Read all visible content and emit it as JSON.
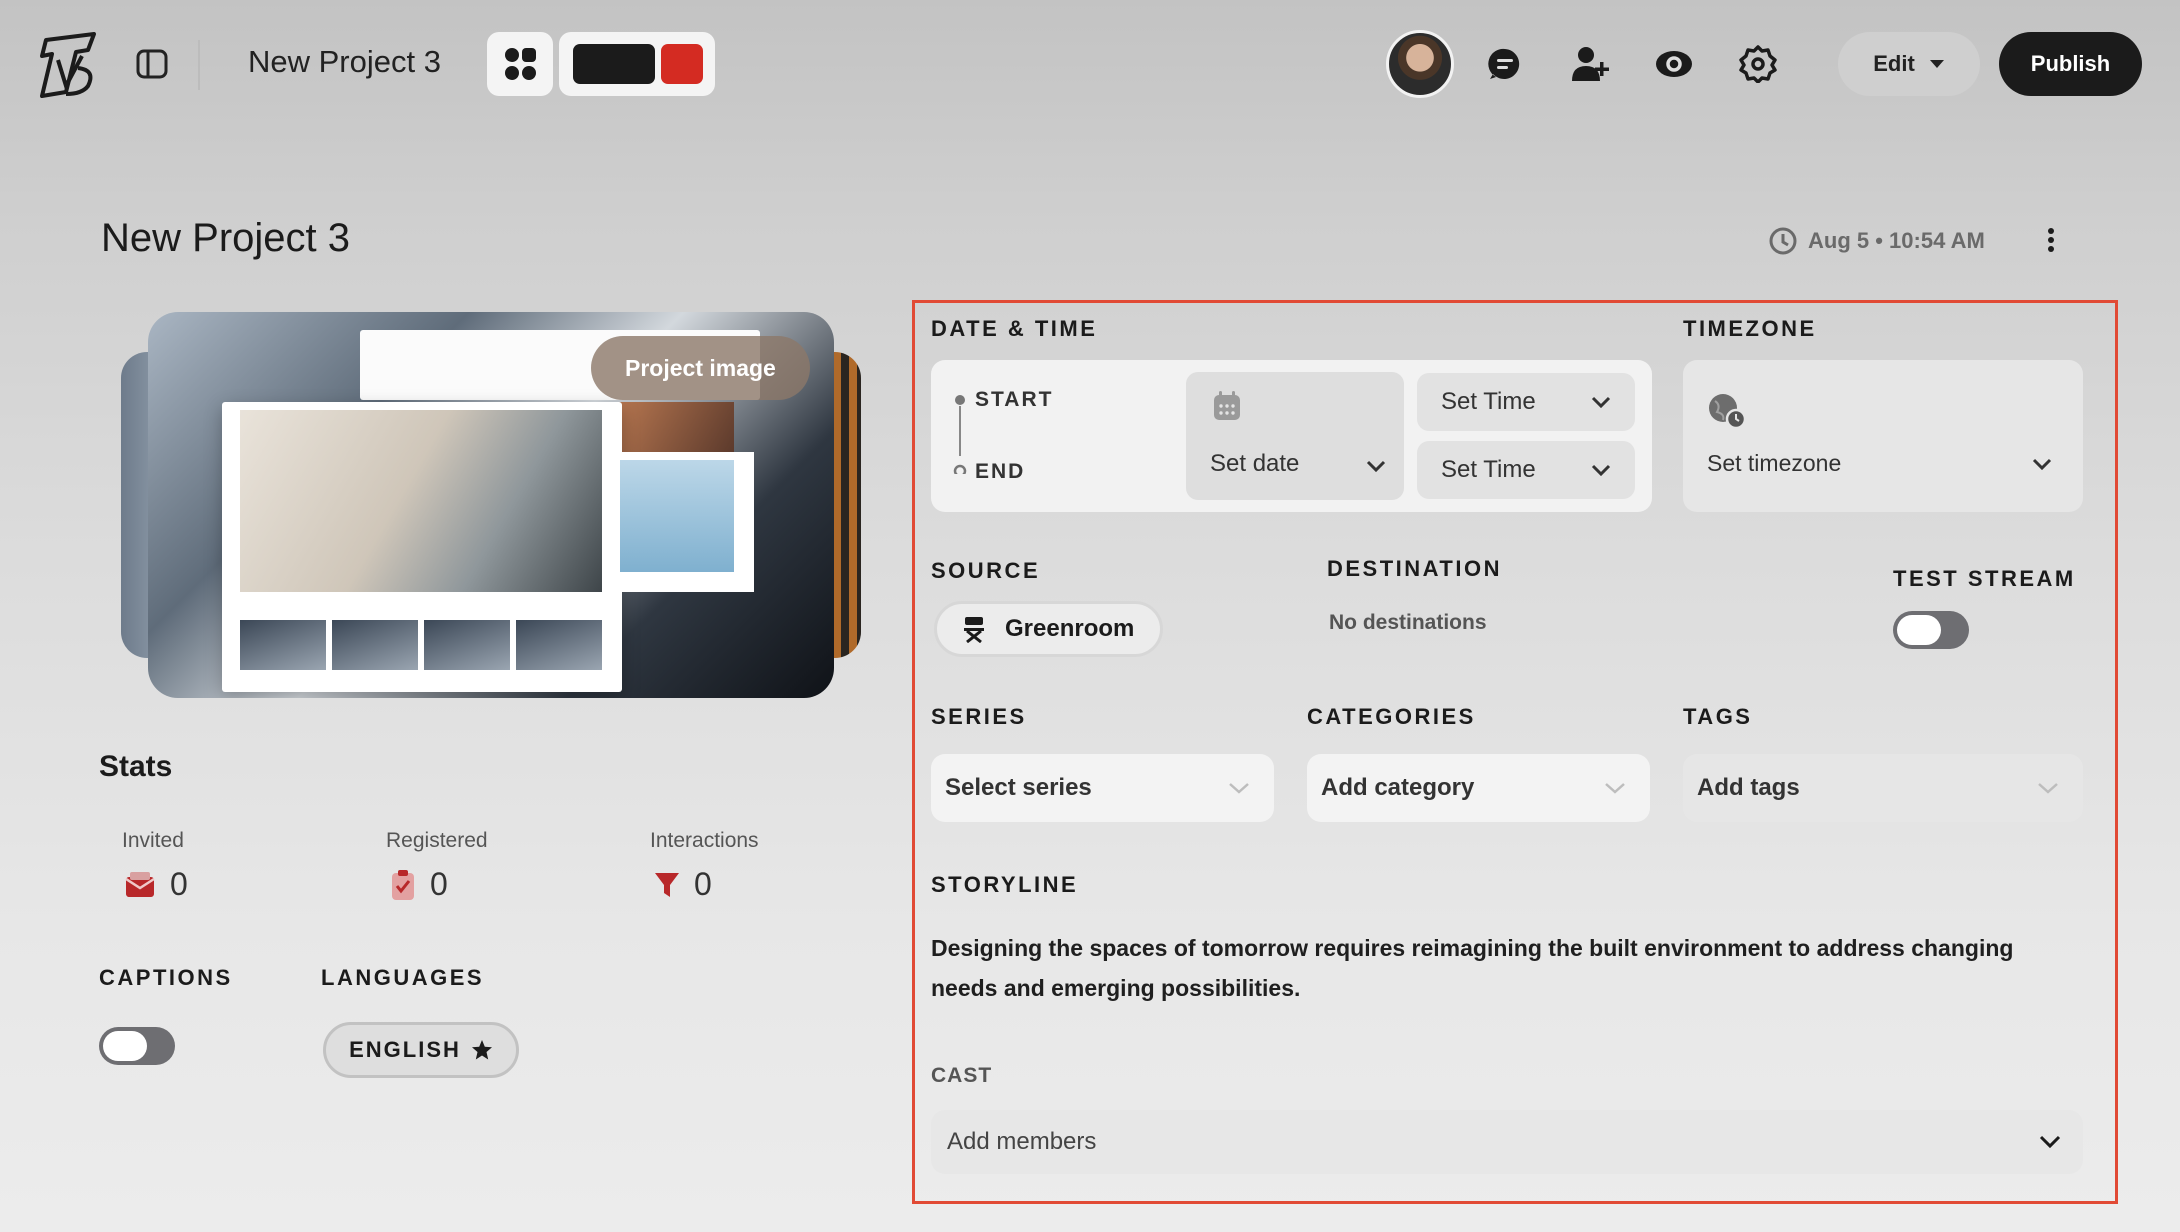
{
  "header": {
    "project_title": "New Project 3",
    "edit_label": "Edit",
    "publish_label": "Publish",
    "colors": {
      "primary_swatch": "#1b1b1b",
      "accent_swatch": "#d42b22"
    }
  },
  "page": {
    "title": "New Project 3",
    "timestamp": "Aug 5 • 10:54 AM",
    "project_image_label": "Project image"
  },
  "stats": {
    "heading": "Stats",
    "items": [
      {
        "label": "Invited",
        "value": "0",
        "icon": "envelope-icon"
      },
      {
        "label": "Registered",
        "value": "0",
        "icon": "clipboard-check-icon"
      },
      {
        "label": "Interactions",
        "value": "0",
        "icon": "funnel-icon"
      }
    ]
  },
  "captions": {
    "label": "CAPTIONS",
    "enabled": false
  },
  "languages": {
    "label": "LANGUAGES",
    "items": [
      "ENGLISH"
    ]
  },
  "details": {
    "datetime_label": "DATE & TIME",
    "start_label": "START",
    "end_label": "END",
    "date_placeholder": "Set date",
    "start_time_placeholder": "Set Time",
    "end_time_placeholder": "Set Time",
    "timezone_label": "TIMEZONE",
    "timezone_placeholder": "Set timezone",
    "source_label": "SOURCE",
    "source_value": "Greenroom",
    "destination_label": "DESTINATION",
    "destination_value": "No destinations",
    "test_stream_label": "TEST STREAM",
    "test_stream_enabled": false,
    "series_label": "SERIES",
    "series_placeholder": "Select series",
    "categories_label": "CATEGORIES",
    "categories_placeholder": "Add category",
    "tags_label": "TAGS",
    "tags_placeholder": "Add tags",
    "storyline_label": "STORYLINE",
    "storyline_text": "Designing the spaces of tomorrow requires reimagining the built environment to address changing needs and emerging possibilities.",
    "cast_label": "CAST",
    "cast_placeholder": "Add members"
  }
}
